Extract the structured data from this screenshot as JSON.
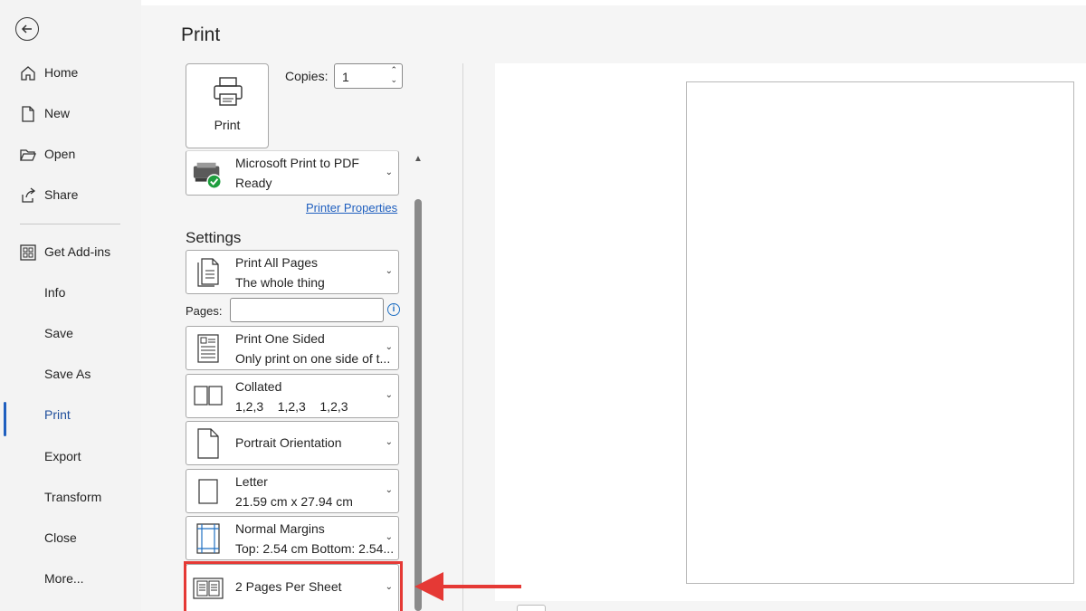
{
  "nav": {
    "items": [
      {
        "label": "Home",
        "icon": "home-icon"
      },
      {
        "label": "New",
        "icon": "new-document-icon"
      },
      {
        "label": "Open",
        "icon": "folder-open-icon"
      },
      {
        "label": "Share",
        "icon": "share-icon"
      },
      {
        "label": "Get Add-ins",
        "icon": "add-ins-icon"
      },
      {
        "label": "Info"
      },
      {
        "label": "Save"
      },
      {
        "label": "Save As"
      },
      {
        "label": "Print"
      },
      {
        "label": "Export"
      },
      {
        "label": "Transform"
      },
      {
        "label": "Close"
      },
      {
        "label": "More..."
      }
    ],
    "active": "Print"
  },
  "page": {
    "title": "Print"
  },
  "print": {
    "button_label": "Print",
    "copies_label": "Copies:",
    "copies_value": "1"
  },
  "printer": {
    "name": "Microsoft Print to PDF",
    "status": "Ready",
    "properties_link": "Printer Properties"
  },
  "settings": {
    "heading": "Settings",
    "pages_label": "Pages:",
    "pages_value": "",
    "options": [
      {
        "line1": "Print All Pages",
        "line2": "The whole thing"
      },
      {
        "line1": "Print One Sided",
        "line2": "Only print on one side of t..."
      },
      {
        "line1": "Collated",
        "line2": "1,2,3    1,2,3    1,2,3"
      },
      {
        "line1": "Portrait Orientation"
      },
      {
        "line1": "Letter",
        "line2": "21.59 cm x 27.94 cm"
      },
      {
        "line1": "Normal Margins",
        "line2": "Top: 2.54 cm Bottom: 2.54..."
      },
      {
        "line1": "2 Pages Per Sheet"
      }
    ]
  },
  "colors": {
    "accent": "#1f5fbf",
    "highlight": "#e53935"
  }
}
